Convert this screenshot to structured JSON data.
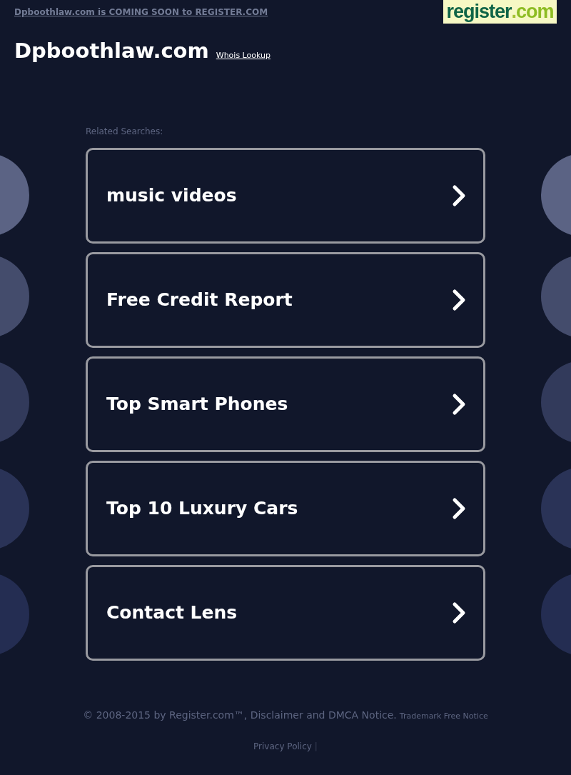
{
  "top_bar": {
    "notice": "Dpboothlaw.com is COMING SOON to REGISTER.COM",
    "logo": {
      "main": "register",
      "dot": ".",
      "tld": "com"
    }
  },
  "header": {
    "domain": "Dpboothlaw.com",
    "whois_link": "Whois Lookup"
  },
  "related": {
    "label": "Related Searches:",
    "items": [
      {
        "text": "music videos"
      },
      {
        "text": "Free Credit Report"
      },
      {
        "text": "Top Smart Phones"
      },
      {
        "text": "Top 10 Luxury Cars"
      },
      {
        "text": "Contact Lens"
      }
    ]
  },
  "footer": {
    "copyright": "© 2008-2015 by Register.com™, Disclaimer and DMCA Notice.",
    "trademark": "Trademark Free Notice",
    "privacy": "Privacy Policy",
    "separator": "|"
  }
}
